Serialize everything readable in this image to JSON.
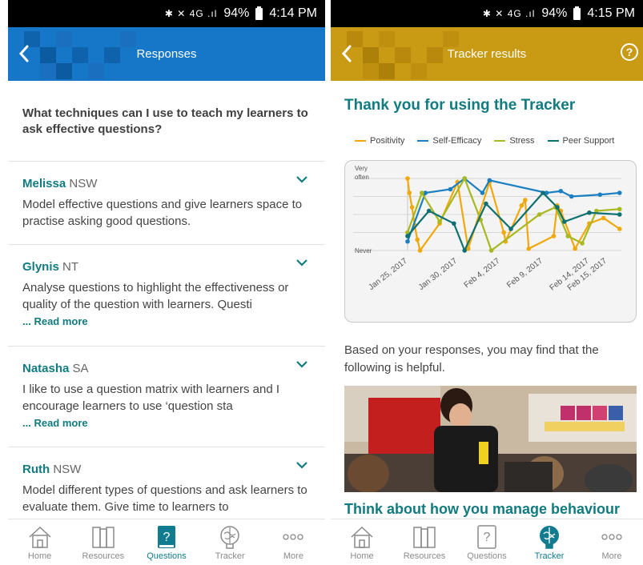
{
  "status_left": {
    "battery": "94%",
    "time": "4:14 PM",
    "icons": "✱ ✕ 4G .ıl"
  },
  "status_right": {
    "battery": "94%",
    "time": "4:15 PM",
    "icons": "✱ ✕ 4G .ıl"
  },
  "left": {
    "header_title": "Responses",
    "question": "What techniques can I use to teach my learners to ask effective questions?",
    "responses": [
      {
        "name": "Melissa",
        "state": "NSW",
        "text": "Model effective questions and give learners space to practise asking good questions.",
        "read_more": ""
      },
      {
        "name": "Glynis",
        "state": "NT",
        "text": "Analyse questions to highlight the effectiveness or quality of the question with learners. Questi",
        "read_more": "... Read more"
      },
      {
        "name": "Natasha",
        "state": "SA",
        "text": "I like to use a question matrix with learners and I encourage learners to use ‘question sta",
        "read_more": "... Read more"
      },
      {
        "name": "Ruth",
        "state": "NSW",
        "text": "Model different types of questions and ask learners to evaluate them. Give time to learners to",
        "read_more": ""
      }
    ]
  },
  "right": {
    "header_title": "Tracker results",
    "help_label": "?",
    "heading": "Thank you for using the Tracker",
    "helpful_text": "Based on your responses, you may find that the following is helpful.",
    "behaviour_heading": "Think about how you manage behaviour"
  },
  "nav": [
    {
      "label": "Home",
      "icon": "home-icon"
    },
    {
      "label": "Resources",
      "icon": "books-icon"
    },
    {
      "label": "Questions",
      "icon": "question-book-icon"
    },
    {
      "label": "Tracker",
      "icon": "brain-icon"
    },
    {
      "label": "More",
      "icon": "more-dots-icon"
    }
  ],
  "colors": {
    "accent_teal": "#117b7f",
    "header_blue": "#1676c8",
    "header_gold": "#c99a14",
    "positivity": "#f0a80a",
    "self_efficacy": "#1b7fc0",
    "stress": "#a8b820",
    "peer_support": "#0e7070"
  },
  "chart_data": {
    "type": "line",
    "x": [
      "Jan 25, 2017",
      "Jan 30, 2017",
      "Feb 4, 2017",
      "Feb 9, 2017",
      "Feb 14, 2017",
      "Feb 15, 2017"
    ],
    "y_tick_labels": [
      "Never",
      "Very often"
    ],
    "ylim": [
      0,
      4
    ],
    "legend_position": "top",
    "grid": true,
    "series": [
      {
        "name": "Positivity",
        "color": "#f0a80a",
        "points": [
          [
            0,
            4
          ],
          [
            0.1,
            3.2
          ],
          [
            0.25,
            2.4
          ],
          [
            0.4,
            1.4
          ],
          [
            0.55,
            0.6
          ],
          [
            0.7,
            0
          ],
          [
            1.8,
            1.5
          ],
          [
            2.8,
            3.8
          ],
          [
            3.4,
            0.1
          ],
          [
            4.6,
            3.8
          ],
          [
            5.4,
            1
          ],
          [
            5.5,
            0.5
          ],
          [
            6.4,
            2.5
          ],
          [
            6.6,
            2.8
          ],
          [
            6.8,
            0.1
          ],
          [
            8.2,
            0.8
          ],
          [
            8.4,
            2.5
          ],
          [
            8.6,
            2.2
          ],
          [
            9.4,
            0.1
          ],
          [
            10.2,
            1.5
          ],
          [
            11.0,
            1.8
          ],
          [
            11.9,
            1.2
          ]
        ]
      },
      {
        "name": "Self-Efficacy",
        "color": "#1b7fc0",
        "points": [
          [
            0,
            0.5
          ],
          [
            1,
            3.2
          ],
          [
            2.4,
            3.4
          ],
          [
            3.2,
            4
          ],
          [
            4.2,
            3.2
          ],
          [
            4.6,
            3.9
          ],
          [
            7.8,
            3.2
          ],
          [
            8.6,
            3.3
          ],
          [
            9.2,
            3.0
          ],
          [
            10.8,
            3.1
          ],
          [
            11.9,
            3.2
          ]
        ]
      },
      {
        "name": "Stress",
        "color": "#a8b820",
        "points": [
          [
            0,
            1.0
          ],
          [
            0.8,
            3.2
          ],
          [
            1.8,
            1.6
          ],
          [
            3.2,
            4
          ],
          [
            4.1,
            1.7
          ],
          [
            4.7,
            0
          ],
          [
            7.4,
            2.0
          ],
          [
            8.3,
            2.4
          ],
          [
            9.0,
            0.8
          ],
          [
            9.8,
            0.4
          ],
          [
            10.6,
            2.2
          ],
          [
            11.9,
            2.3
          ]
        ]
      },
      {
        "name": "Peer Support",
        "color": "#0e7070",
        "points": [
          [
            0,
            0.8
          ],
          [
            1.2,
            2.2
          ],
          [
            2.6,
            1.5
          ],
          [
            3.2,
            0
          ],
          [
            4.4,
            2.6
          ],
          [
            5.8,
            1.2
          ],
          [
            7.6,
            3.2
          ],
          [
            8.4,
            2.4
          ],
          [
            8.8,
            1.6
          ],
          [
            10.2,
            2.1
          ],
          [
            11.9,
            2.0
          ]
        ]
      }
    ]
  }
}
